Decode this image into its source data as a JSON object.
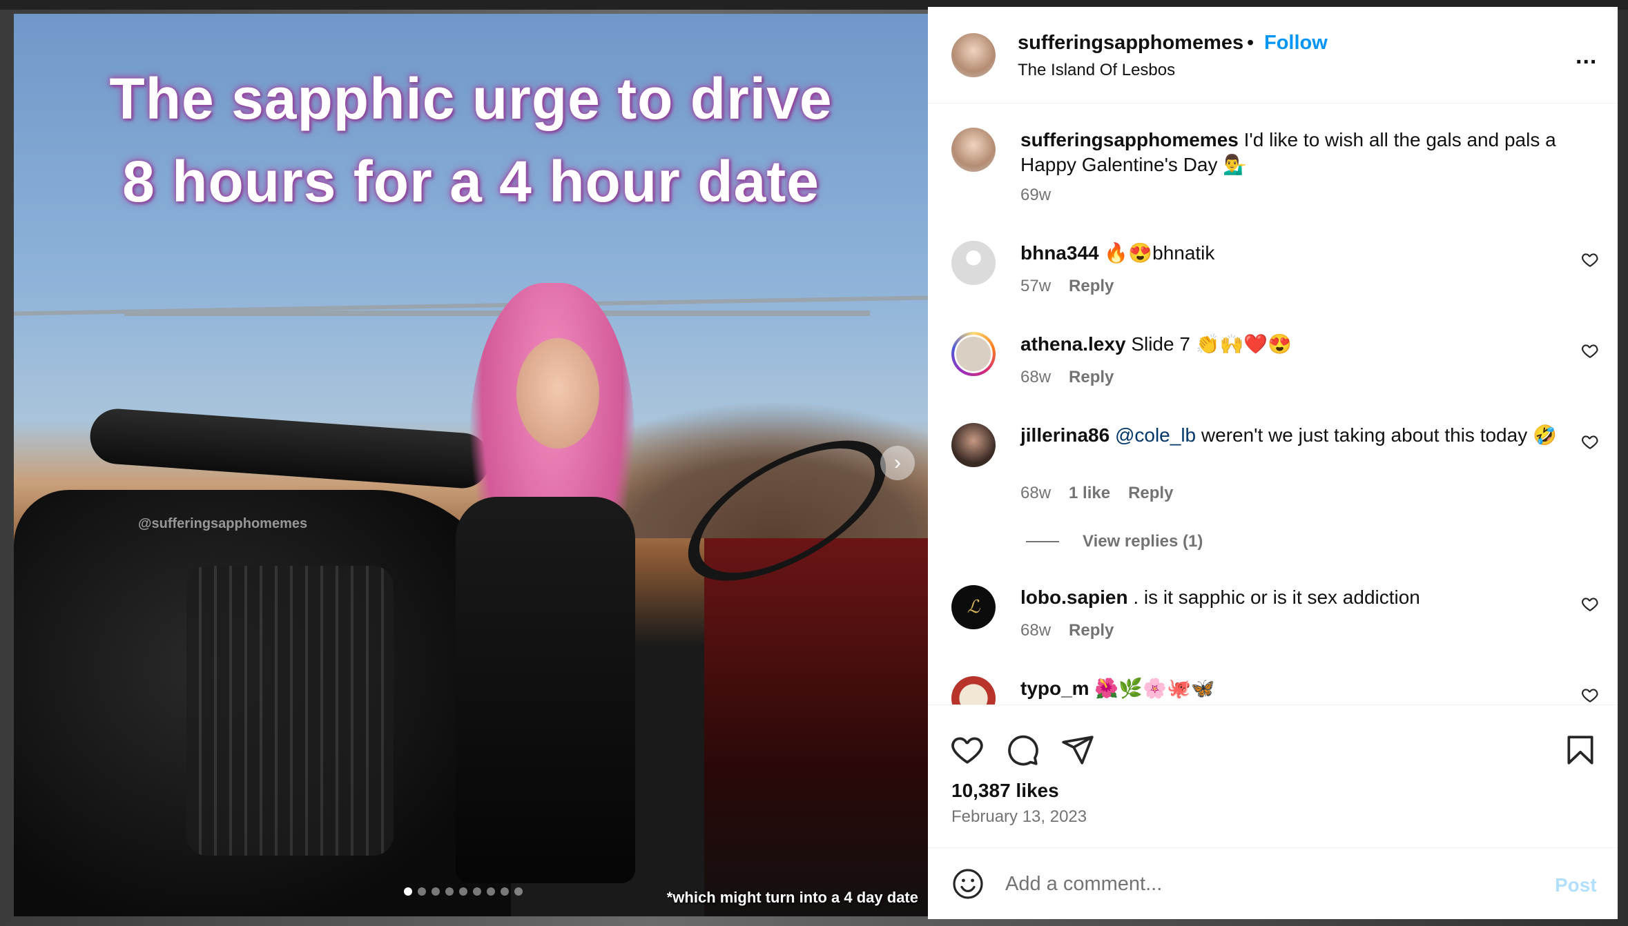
{
  "post": {
    "caption_line1": "The sapphic urge to drive",
    "caption_line2": "8 hours for a 4 hour date",
    "watermark": "@sufferingsapphomemes",
    "footnote": "*which might turn into a 4 day date",
    "slide_count": 9,
    "active_slide": 1
  },
  "header": {
    "username": "sufferingsapphomemes",
    "separator": "•",
    "follow_label": "Follow",
    "location": "The Island Of Lesbos",
    "more_label": "..."
  },
  "caption_comment": {
    "username": "sufferingsapphomemes",
    "text": "I'd like to wish all the gals and pals a Happy Galentine's Day 💁‍♂️",
    "age": "69w"
  },
  "comments": [
    {
      "username": "bhna344",
      "text": "🔥😍bhnatik",
      "age": "57w",
      "likes": "",
      "reply_label": "Reply"
    },
    {
      "username": "athena.lexy",
      "text": "Slide 7 👏🙌❤️😍",
      "age": "68w",
      "likes": "",
      "reply_label": "Reply"
    },
    {
      "username": "jillerina86",
      "mention": "@cole_lb",
      "text": "weren't we just taking about this today 🤣",
      "age": "68w",
      "likes": "1 like",
      "reply_label": "Reply",
      "view_replies": "View replies (1)"
    },
    {
      "username": "lobo.sapien",
      "text": ". is it sapphic or is it sex addiction",
      "age": "68w",
      "likes": "",
      "reply_label": "Reply"
    },
    {
      "username": "typo_m",
      "text": "🌺🌿🌸🐙🦋",
      "age": "",
      "likes": "",
      "reply_label": ""
    }
  ],
  "stats": {
    "likes": "10,387 likes",
    "date": "February 13, 2023"
  },
  "composer": {
    "placeholder": "Add a comment...",
    "post_label": "Post"
  },
  "icons": [
    "like-icon",
    "comment-icon",
    "share-icon",
    "bookmark-icon",
    "emoji-icon",
    "more-icon",
    "chevron-right-icon",
    "heart-icon"
  ],
  "colors": {
    "accent": "#0095f6",
    "post_disabled": "#b2dffc",
    "muted": "#737373",
    "mention": "#00376b"
  }
}
